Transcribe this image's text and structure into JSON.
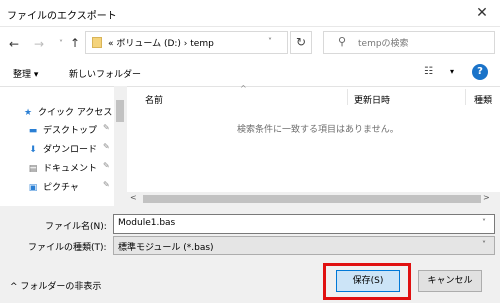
{
  "window": {
    "title": "ファイルのエクスポート",
    "close_glyph": "✕"
  },
  "nav": {
    "back_glyph": "←",
    "forward_glyph": "→",
    "history_glyph": "˅",
    "up_glyph": "↑",
    "address_path": "«  ボリューム (D:)  ›  temp",
    "address_dropdown_glyph": "˅",
    "refresh_glyph": "↻",
    "search_glyph": "⚲",
    "search_placeholder": "tempの検索"
  },
  "toolbar": {
    "organize": "整理 ▾",
    "new_folder": "新しいフォルダー",
    "view_glyph": "☷",
    "view_dropdown_glyph": "▾",
    "help": "?"
  },
  "sidebar": {
    "items": [
      {
        "icon": "★",
        "label": "クイック アクセス",
        "pinned": false
      },
      {
        "icon": "▬",
        "label": "デスクトップ",
        "pinned": true
      },
      {
        "icon": "⬇",
        "label": "ダウンロード",
        "pinned": true
      },
      {
        "icon": "▤",
        "label": "ドキュメント",
        "pinned": true
      },
      {
        "icon": "▣",
        "label": "ピクチャ",
        "pinned": true
      }
    ],
    "pin_glyph": "📌"
  },
  "filelist": {
    "columns": [
      "名前",
      "更新日時",
      "種類"
    ],
    "sort_glyph": "^",
    "empty_message": "検索条件に一致する項目はありません。",
    "scroll_left": "<",
    "scroll_right": ">"
  },
  "form": {
    "filename_label": "ファイル名(N):",
    "filename_value": "Module1.bas",
    "filetype_label": "ファイルの種類(T):",
    "filetype_value": "標準モジュール (*.bas)",
    "dropdown_glyph": "˅"
  },
  "footer": {
    "hide_folders": "^  フォルダーの非表示",
    "save": "保存(S)",
    "cancel": "キャンセル"
  },
  "colors": {
    "accent": "#0078d7",
    "highlight_box": "#e01010"
  }
}
